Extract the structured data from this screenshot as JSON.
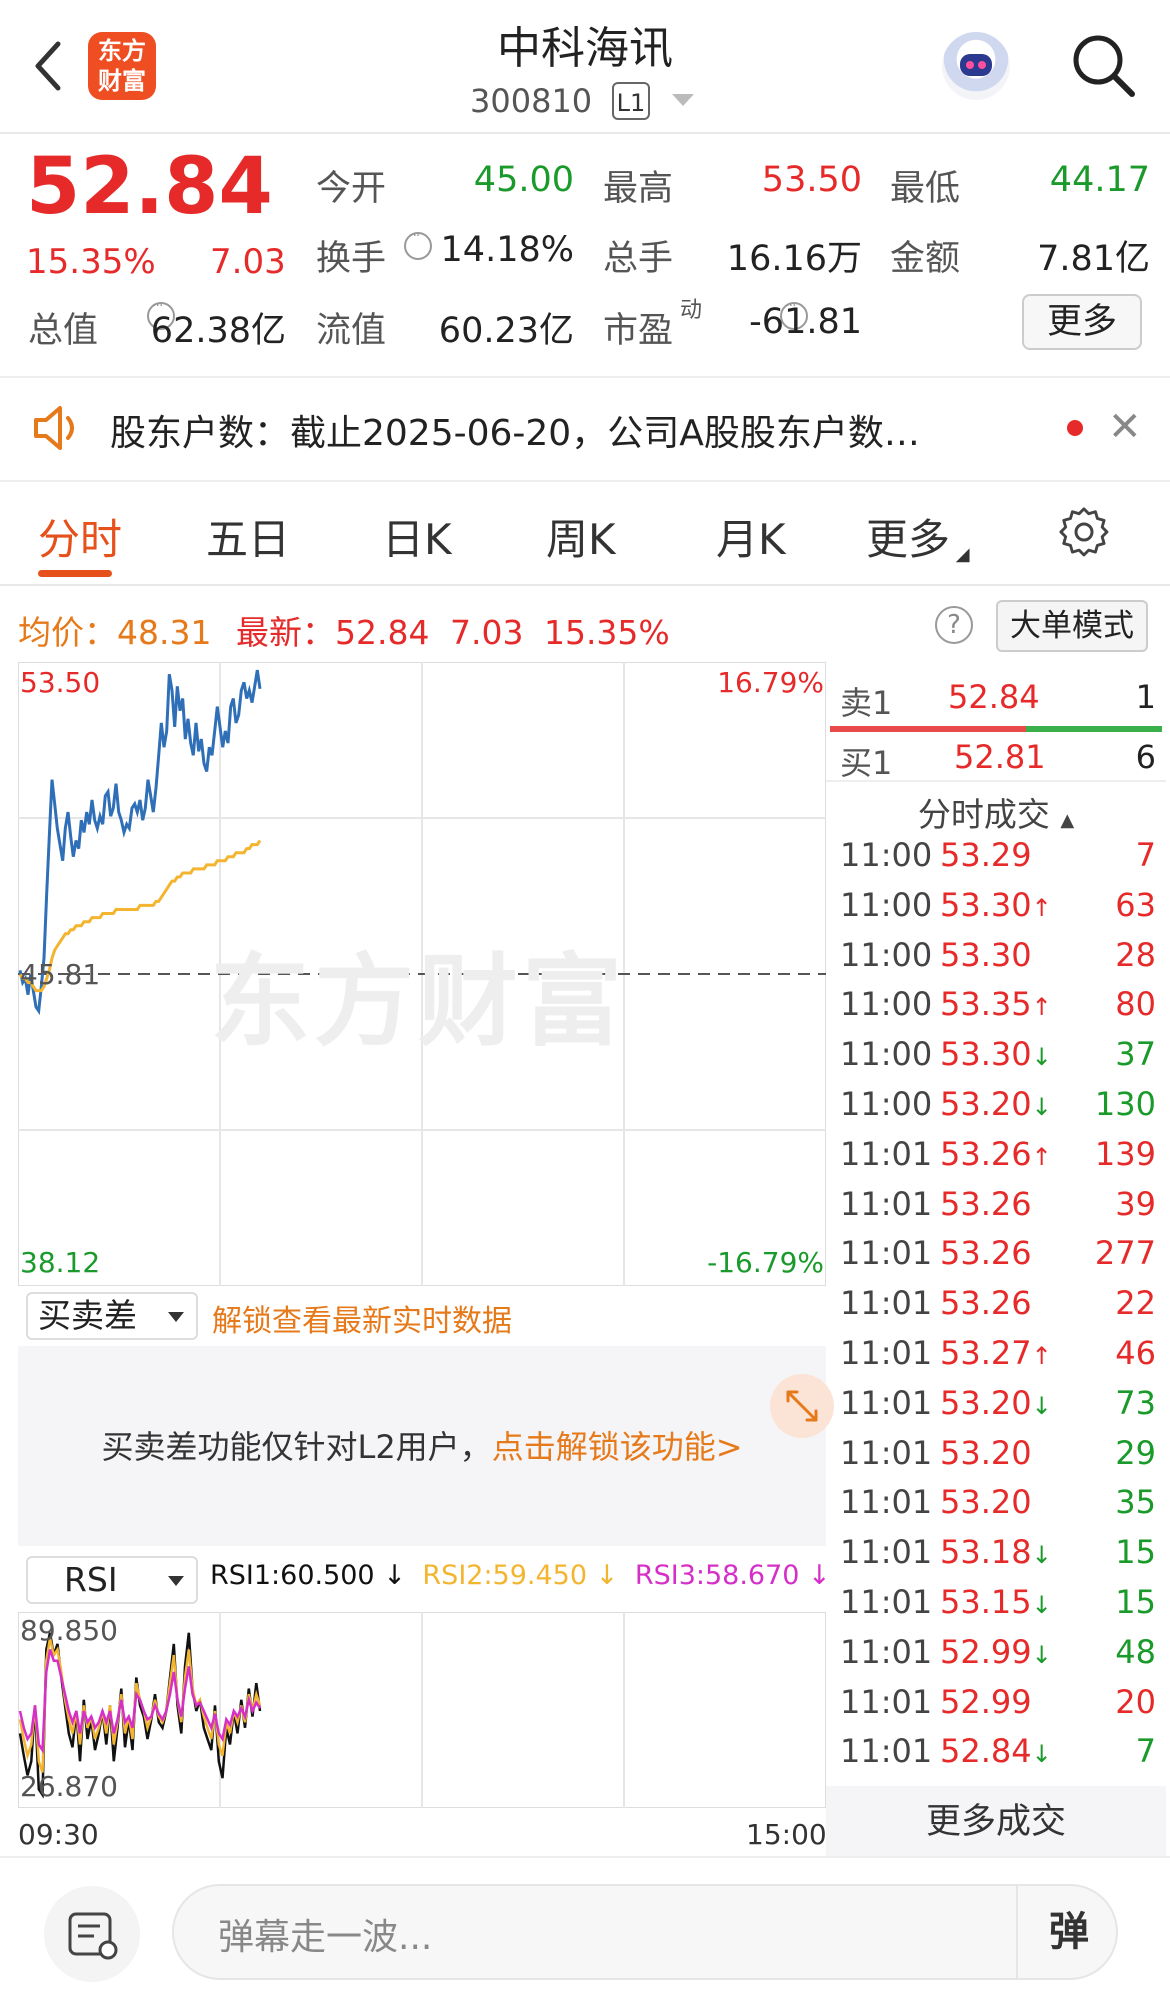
{
  "header": {
    "title": "中科海讯",
    "code": "300810",
    "level": "L1",
    "logo_line1": "东方",
    "logo_line2": "财富"
  },
  "quote": {
    "price": "52.84",
    "change_pct": "15.35%",
    "change_amt": "7.03",
    "open_label": "今开",
    "open": "45.00",
    "high_label": "最高",
    "high": "53.50",
    "low_label": "最低",
    "low": "44.17",
    "turnover_label": "换手",
    "turnover": "14.18%",
    "volume_label": "总手",
    "volume": "16.16万",
    "amount_label": "金额",
    "amount": "7.81亿",
    "mktcap_label": "总值",
    "mktcap": "62.38亿",
    "float_label": "流值",
    "float": "60.23亿",
    "pe_label": "市盈",
    "pe_sup": "动",
    "pe": "-61.81",
    "more": "更多"
  },
  "notice": {
    "text": "股东户数：截止2025-06-20，公司A股股东户数…"
  },
  "tabs": [
    {
      "label": "分时",
      "active": true
    },
    {
      "label": "五日"
    },
    {
      "label": "日K"
    },
    {
      "label": "周K"
    },
    {
      "label": "月K"
    },
    {
      "label": "更多"
    }
  ],
  "priceline": {
    "avg_label": "均价：",
    "avg": "48.31",
    "latest_label": "最新：",
    "latest": "52.84",
    "chg": "7.03",
    "pct": "15.35%",
    "mode_button": "大单模式"
  },
  "chart_data": {
    "type": "line",
    "ylim": [
      38.12,
      53.5
    ],
    "y_top_label": "53.50",
    "y_bottom_label": "38.12",
    "y_mid_label": "45.81",
    "pct_top_label": "16.79%",
    "pct_bottom_label": "-16.79%",
    "x_start": "09:30",
    "x_end": "15:00",
    "series": [
      {
        "color": "#2f6fb8",
        "values": [
          45.9,
          45.6,
          45.7,
          45.3,
          45.8,
          45.4,
          45.0,
          44.9,
          45.5,
          46.2,
          47.8,
          49.2,
          50.6,
          50.0,
          49.4,
          49.0,
          48.6,
          49.4,
          49.8,
          49.2,
          48.7,
          49.1,
          48.9,
          49.6,
          49.3,
          49.8,
          49.5,
          50.1,
          49.6,
          49.4,
          49.7,
          49.5,
          50.2,
          50.3,
          49.7,
          49.9,
          50.5,
          49.8,
          49.6,
          49.3,
          49.5,
          49.4,
          49.9,
          50.0,
          49.8,
          50.1,
          49.6,
          49.9,
          50.6,
          50.2,
          49.8,
          50.4,
          51.2,
          52.0,
          51.4,
          51.8,
          53.2,
          52.8,
          51.9,
          52.9,
          52.3,
          52.6,
          51.6,
          52.1,
          51.5,
          51.2,
          52.0,
          51.3,
          51.6,
          51.0,
          50.8,
          51.4,
          51.2,
          51.8,
          52.4,
          51.9,
          51.4,
          51.8,
          51.5,
          52.4,
          52.6,
          52.0,
          52.2,
          52.8,
          53.0,
          52.6,
          52.8,
          52.5,
          52.9,
          53.3,
          52.84
        ]
      },
      {
        "color": "#f3b530",
        "values": [
          45.8,
          45.7,
          45.7,
          45.6,
          45.6,
          45.5,
          45.4,
          45.4,
          45.4,
          45.5,
          45.7,
          45.9,
          46.2,
          46.4,
          46.5,
          46.6,
          46.7,
          46.8,
          46.8,
          46.9,
          46.9,
          47.0,
          47.0,
          47.0,
          47.1,
          47.1,
          47.1,
          47.2,
          47.2,
          47.2,
          47.2,
          47.3,
          47.3,
          47.3,
          47.3,
          47.3,
          47.4,
          47.4,
          47.4,
          47.4,
          47.4,
          47.4,
          47.4,
          47.4,
          47.4,
          47.5,
          47.5,
          47.5,
          47.5,
          47.5,
          47.5,
          47.6,
          47.6,
          47.7,
          47.8,
          47.9,
          48.0,
          48.1,
          48.1,
          48.2,
          48.2,
          48.3,
          48.3,
          48.3,
          48.3,
          48.4,
          48.4,
          48.4,
          48.4,
          48.4,
          48.5,
          48.5,
          48.5,
          48.5,
          48.6,
          48.6,
          48.6,
          48.6,
          48.7,
          48.7,
          48.7,
          48.8,
          48.8,
          48.8,
          48.8,
          48.9,
          48.9,
          49.0,
          49.0,
          49.0,
          49.1
        ]
      }
    ]
  },
  "orderbook": {
    "sell": {
      "label": "卖1",
      "price": "52.84",
      "qty": "1"
    },
    "buy": {
      "label": "买1",
      "price": "52.81",
      "qty": "6"
    },
    "trades_title": "分时成交",
    "trades": [
      {
        "time": "11:00",
        "price": "53.29",
        "arrow": "",
        "vol": "7",
        "color": "red"
      },
      {
        "time": "11:00",
        "price": "53.30",
        "arrow": "↑",
        "vol": "63",
        "color": "red"
      },
      {
        "time": "11:00",
        "price": "53.30",
        "arrow": "",
        "vol": "28",
        "color": "red"
      },
      {
        "time": "11:00",
        "price": "53.35",
        "arrow": "↑",
        "vol": "80",
        "color": "red"
      },
      {
        "time": "11:00",
        "price": "53.30",
        "arrow": "↓",
        "vol": "37",
        "color": "green"
      },
      {
        "time": "11:00",
        "price": "53.20",
        "arrow": "↓",
        "vol": "130",
        "color": "green"
      },
      {
        "time": "11:01",
        "price": "53.26",
        "arrow": "↑",
        "vol": "139",
        "color": "red"
      },
      {
        "time": "11:01",
        "price": "53.26",
        "arrow": "",
        "vol": "39",
        "color": "red"
      },
      {
        "time": "11:01",
        "price": "53.26",
        "arrow": "",
        "vol": "277",
        "color": "red"
      },
      {
        "time": "11:01",
        "price": "53.26",
        "arrow": "",
        "vol": "22",
        "color": "red"
      },
      {
        "time": "11:01",
        "price": "53.27",
        "arrow": "↑",
        "vol": "46",
        "color": "red"
      },
      {
        "time": "11:01",
        "price": "53.20",
        "arrow": "↓",
        "vol": "73",
        "color": "green"
      },
      {
        "time": "11:01",
        "price": "53.20",
        "arrow": "",
        "vol": "29",
        "color": "green"
      },
      {
        "time": "11:01",
        "price": "53.20",
        "arrow": "",
        "vol": "35",
        "color": "green"
      },
      {
        "time": "11:01",
        "price": "53.18",
        "arrow": "↓",
        "vol": "15",
        "color": "green"
      },
      {
        "time": "11:01",
        "price": "53.15",
        "arrow": "↓",
        "vol": "15",
        "color": "green"
      },
      {
        "time": "11:01",
        "price": "52.99",
        "arrow": "↓",
        "vol": "48",
        "color": "green"
      },
      {
        "time": "11:01",
        "price": "52.99",
        "arrow": "",
        "vol": "20",
        "color": "red"
      },
      {
        "time": "11:01",
        "price": "52.84",
        "arrow": "↓",
        "vol": "7",
        "color": "green"
      }
    ],
    "more_trades": "更多成交"
  },
  "bsd": {
    "select": "买卖差",
    "unlock": "解锁查看最新实时数据",
    "msg": "买卖差功能仅针对L2用户，",
    "msg_link": "点击解锁该功能>"
  },
  "rsi": {
    "select": "RSI",
    "rsi1": "RSI1:60.500 ↓",
    "rsi2": "RSI2:59.450 ↓",
    "rsi3": "RSI3:58.670 ↓",
    "top_label": "89.850",
    "bottom_label": "26.870",
    "series": [
      {
        "color": "#111111",
        "values": [
          50,
          42,
          35,
          40,
          60,
          30,
          28,
          80,
          86,
          78,
          82,
          70,
          60,
          50,
          45,
          58,
          40,
          62,
          48,
          55,
          44,
          50,
          58,
          46,
          60,
          40,
          52,
          66,
          45,
          55,
          44,
          70,
          60,
          56,
          48,
          55,
          64,
          54,
          52,
          58,
          70,
          82,
          60,
          50,
          74,
          86,
          66,
          58,
          62,
          52,
          48,
          44,
          60,
          40,
          34,
          52,
          46,
          58,
          50,
          62,
          52,
          66,
          56,
          68,
          58
        ]
      },
      {
        "color": "#f3b530",
        "values": [
          55,
          48,
          42,
          46,
          60,
          40,
          36,
          76,
          84,
          78,
          80,
          72,
          62,
          55,
          50,
          58,
          46,
          60,
          52,
          56,
          48,
          52,
          58,
          50,
          60,
          46,
          54,
          64,
          50,
          56,
          48,
          68,
          62,
          58,
          52,
          56,
          62,
          56,
          54,
          58,
          68,
          78,
          62,
          54,
          70,
          80,
          66,
          60,
          62,
          56,
          52,
          48,
          58,
          46,
          42,
          54,
          50,
          58,
          54,
          60,
          54,
          64,
          58,
          64,
          60
        ]
      },
      {
        "color": "#d62fc8",
        "values": [
          58,
          52,
          48,
          50,
          60,
          46,
          44,
          72,
          80,
          76,
          76,
          70,
          64,
          58,
          54,
          58,
          50,
          58,
          54,
          56,
          52,
          54,
          58,
          54,
          58,
          50,
          55,
          62,
          54,
          56,
          52,
          64,
          62,
          58,
          55,
          56,
          60,
          57,
          55,
          58,
          64,
          72,
          62,
          56,
          66,
          74,
          64,
          60,
          61,
          58,
          55,
          52,
          57,
          50,
          48,
          55,
          53,
          58,
          56,
          59,
          56,
          62,
          58,
          61,
          59
        ]
      }
    ]
  },
  "bottom": {
    "placeholder": "弹幕走一波...",
    "send": "弹"
  }
}
